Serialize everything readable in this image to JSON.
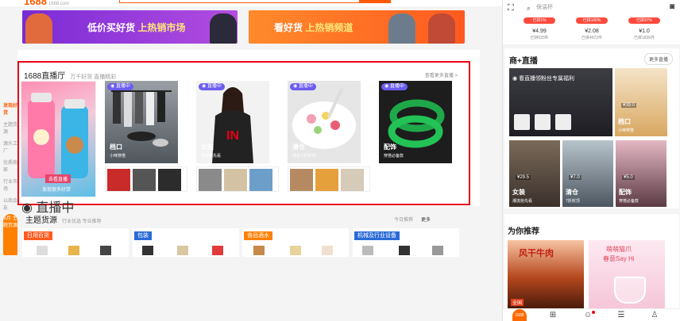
{
  "header": {
    "logo": "1688",
    "logo_sub": "1688.com"
  },
  "banners": [
    {
      "text_a": "低价买好货 ",
      "text_b": "上热销市场"
    },
    {
      "text_a": "看好货 ",
      "text_b": "上热销频道"
    }
  ],
  "live_hall": {
    "title": "1688直播厅",
    "subtitle": "万千好货 直播精彩",
    "more": "查看更多直播 >",
    "tag": "直播中",
    "featured": {
      "badge": "去看直播",
      "sub": "发现很多好货"
    },
    "cards": [
      {
        "name": "档口",
        "sub": "小咪穿搭"
      },
      {
        "name": "女装",
        "sub": "潮流抢先看"
      },
      {
        "name": "清仓",
        "sub": "清仓-7折封顶"
      },
      {
        "name": "配饰",
        "sub": "穿搭必备款"
      }
    ]
  },
  "side_nav": {
    "active": "发现好货",
    "items": [
      "主题货源",
      "源头工厂",
      "优质商家",
      "行业市场",
      "以商会友"
    ]
  },
  "side_badge": "8月 主题货源",
  "theme_section": {
    "title": "主题货源",
    "subtitle": "行业优选 专业推荐",
    "today": "今日推荐",
    "more": "更多"
  },
  "industries": [
    {
      "label": "日用百货",
      "color": "#ff5a1f"
    },
    {
      "label": "包装",
      "color": "#2a6bd6"
    },
    {
      "label": "食品酒水",
      "color": "#ff7f00"
    },
    {
      "label": "机械及行业设备",
      "color": "#2a6bd6"
    }
  ],
  "mobile": {
    "search_placeholder": "保温杯",
    "deals": [
      {
        "pill": "已拼1%",
        "price": "¥4.99",
        "sold": "已拼620件"
      },
      {
        "pill": "已拼100%",
        "price": "¥2.08",
        "sold": "已拼4972件"
      },
      {
        "pill": "已拼97%",
        "price": "¥1.0",
        "sold": "已拼1826件"
      }
    ],
    "live": {
      "title": "商+直播",
      "more": "更多直播",
      "hero_text": "看直播领粉丝专属福利",
      "side": {
        "name": "档口",
        "sub": "小咪穿搭",
        "price": "¥39.0"
      },
      "smalls": [
        {
          "name": "女装",
          "sub": "潮流抢先看",
          "price": "¥29.5"
        },
        {
          "name": "清仓",
          "sub": "7折封顶",
          "price": "¥7.0"
        },
        {
          "name": "配饰",
          "sub": "穿搭必备款",
          "price": "¥5.0"
        }
      ]
    },
    "recommend": {
      "title": "为你推荐",
      "item1": "风干牛肉",
      "item1_badge": "全国",
      "item2_line1": "萌萌猫爪",
      "item2_line2": "春意Say Hi"
    },
    "tabbar": {
      "home": "1688"
    }
  }
}
